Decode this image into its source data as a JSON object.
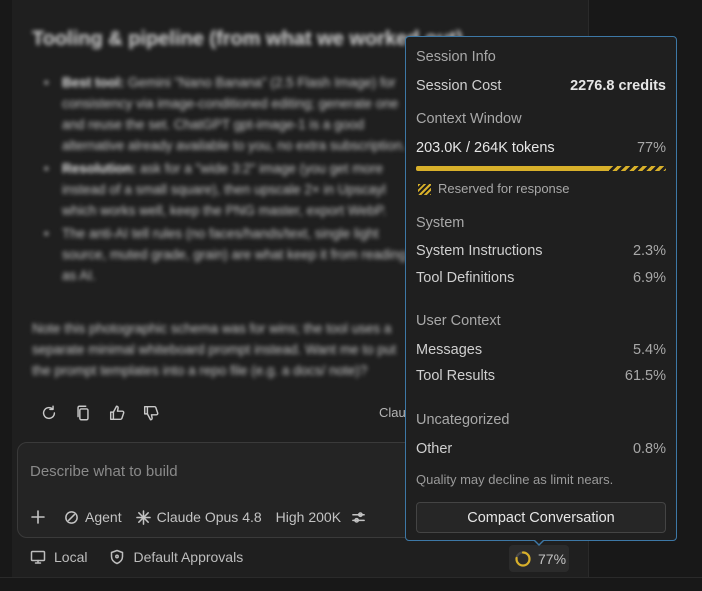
{
  "chat": {
    "blurred_title": "Tooling & pipeline (from what we worked out)",
    "blurred_bullets": [
      {
        "bold": "Best tool:",
        "text": " Gemini \"Nano Banana\" (2.5 Flash Image) for consistency via image-conditioned editing; generate one and reuse the set. ChatGPT gpt-image-1 is a good alternative already available to you, no extra subscription."
      },
      {
        "bold": "Resolution:",
        "text": " ask for a \"wide 3:2\" image (you get more instead of a small square), then upscale 2× in Upscayl which works well, keep the PNG master, export WebP."
      },
      {
        "bold": "",
        "text": "The anti-AI tell rules (no faces/hands/text, single light source, muted grade, grain) are what keep it from reading as AI."
      }
    ],
    "blurred_note": "Note this photographic schema was for wins; the tool uses a separate minimal whiteboard prompt instead. Want me to put the prompt templates into a repo file (e.g. a docs/ note)?",
    "author_tag": "Claude",
    "composer_placeholder": "Describe what to build",
    "agent_label": "Agent",
    "model_label": "Claude Opus 4.8",
    "effort_label": "High 200K",
    "status_local": "Local",
    "status_approvals": "Default Approvals",
    "context_percent": "77%",
    "context_fraction": 0.77
  },
  "popup": {
    "session_title": "Session Info",
    "session_cost_label": "Session Cost",
    "session_cost_value": "2276.8 credits",
    "context_title": "Context Window",
    "tokens_label": "203.0K / 264K tokens",
    "tokens_percent": "77%",
    "used_fraction": 0.77,
    "reserved_fraction": 0.23,
    "reserved_label": "Reserved for response",
    "system_title": "System",
    "system_instructions_label": "System Instructions",
    "system_instructions_value": "2.3%",
    "tool_definitions_label": "Tool Definitions",
    "tool_definitions_value": "6.9%",
    "user_context_title": "User Context",
    "messages_label": "Messages",
    "messages_value": "5.4%",
    "tool_results_label": "Tool Results",
    "tool_results_value": "61.5%",
    "uncategorized_title": "Uncategorized",
    "other_label": "Other",
    "other_value": "0.8%",
    "quality_note": "Quality may decline as limit nears.",
    "compact_label": "Compact Conversation"
  },
  "colors": {
    "accent_yellow": "#d8b02a",
    "popup_border": "#3d78a6"
  }
}
